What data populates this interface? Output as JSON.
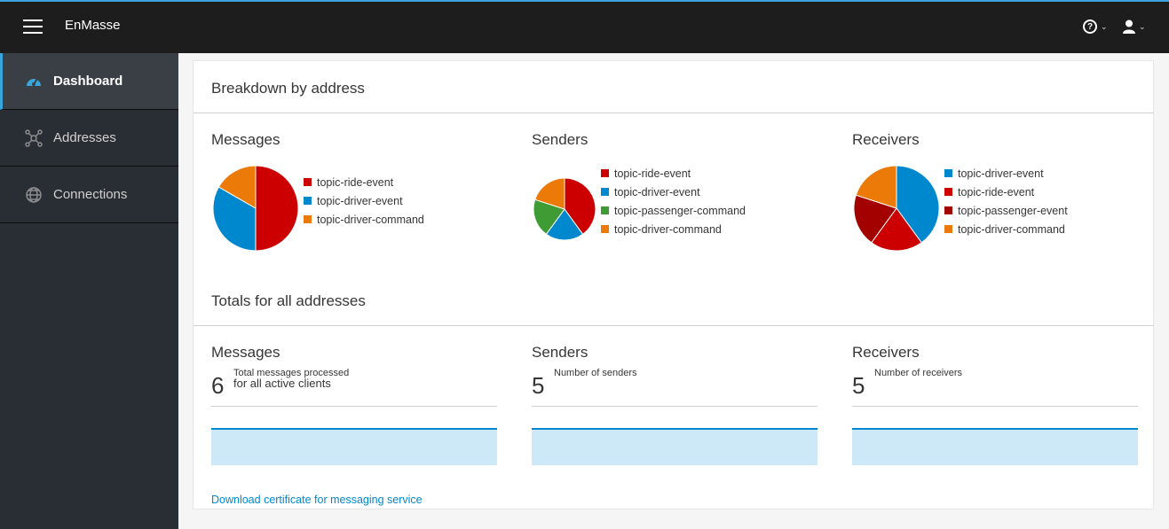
{
  "header": {
    "brand": "EnMasse",
    "help_icon": "question-circle-icon",
    "user_icon": "user-icon"
  },
  "sidebar": {
    "items": [
      {
        "label": "Dashboard",
        "icon": "dashboard-icon",
        "active": true
      },
      {
        "label": "Addresses",
        "icon": "network-icon",
        "active": false
      },
      {
        "label": "Connections",
        "icon": "globe-icon",
        "active": false
      }
    ]
  },
  "colors": {
    "red": "#cc0000",
    "blue": "#0088ce",
    "orange": "#ec7a08",
    "green": "#3f9c35",
    "darkred": "#a30000"
  },
  "breakdown": {
    "title": "Breakdown by address",
    "messages": {
      "title": "Messages",
      "legend": [
        "topic-ride-event",
        "topic-driver-event",
        "topic-driver-command"
      ]
    },
    "senders": {
      "title": "Senders",
      "legend": [
        "topic-ride-event",
        "topic-driver-event",
        "topic-passenger-command",
        "topic-driver-command"
      ]
    },
    "receivers": {
      "title": "Receivers",
      "legend": [
        "topic-driver-event",
        "topic-ride-event",
        "topic-passenger-event",
        "topic-driver-command"
      ]
    }
  },
  "chart_data": [
    {
      "type": "pie",
      "title": "Messages",
      "categories": [
        "topic-ride-event",
        "topic-driver-event",
        "topic-driver-command"
      ],
      "values": [
        3,
        2,
        1
      ]
    },
    {
      "type": "pie",
      "title": "Senders",
      "categories": [
        "topic-ride-event",
        "topic-driver-event",
        "topic-passenger-command",
        "topic-driver-command"
      ],
      "values": [
        2,
        1,
        1,
        1
      ]
    },
    {
      "type": "pie",
      "title": "Receivers",
      "categories": [
        "topic-driver-event",
        "topic-ride-event",
        "topic-passenger-event",
        "topic-driver-command"
      ],
      "values": [
        2,
        1,
        1,
        1
      ]
    }
  ],
  "totals": {
    "title": "Totals for all addresses",
    "messages": {
      "title": "Messages",
      "value": "6",
      "desc1": "Total messages processed",
      "desc2": "for all active clients"
    },
    "senders": {
      "title": "Senders",
      "value": "5",
      "desc1": "Number of senders"
    },
    "receivers": {
      "title": "Receivers",
      "value": "5",
      "desc1": "Number of receivers"
    }
  },
  "download_link": "Download certificate for messaging service"
}
